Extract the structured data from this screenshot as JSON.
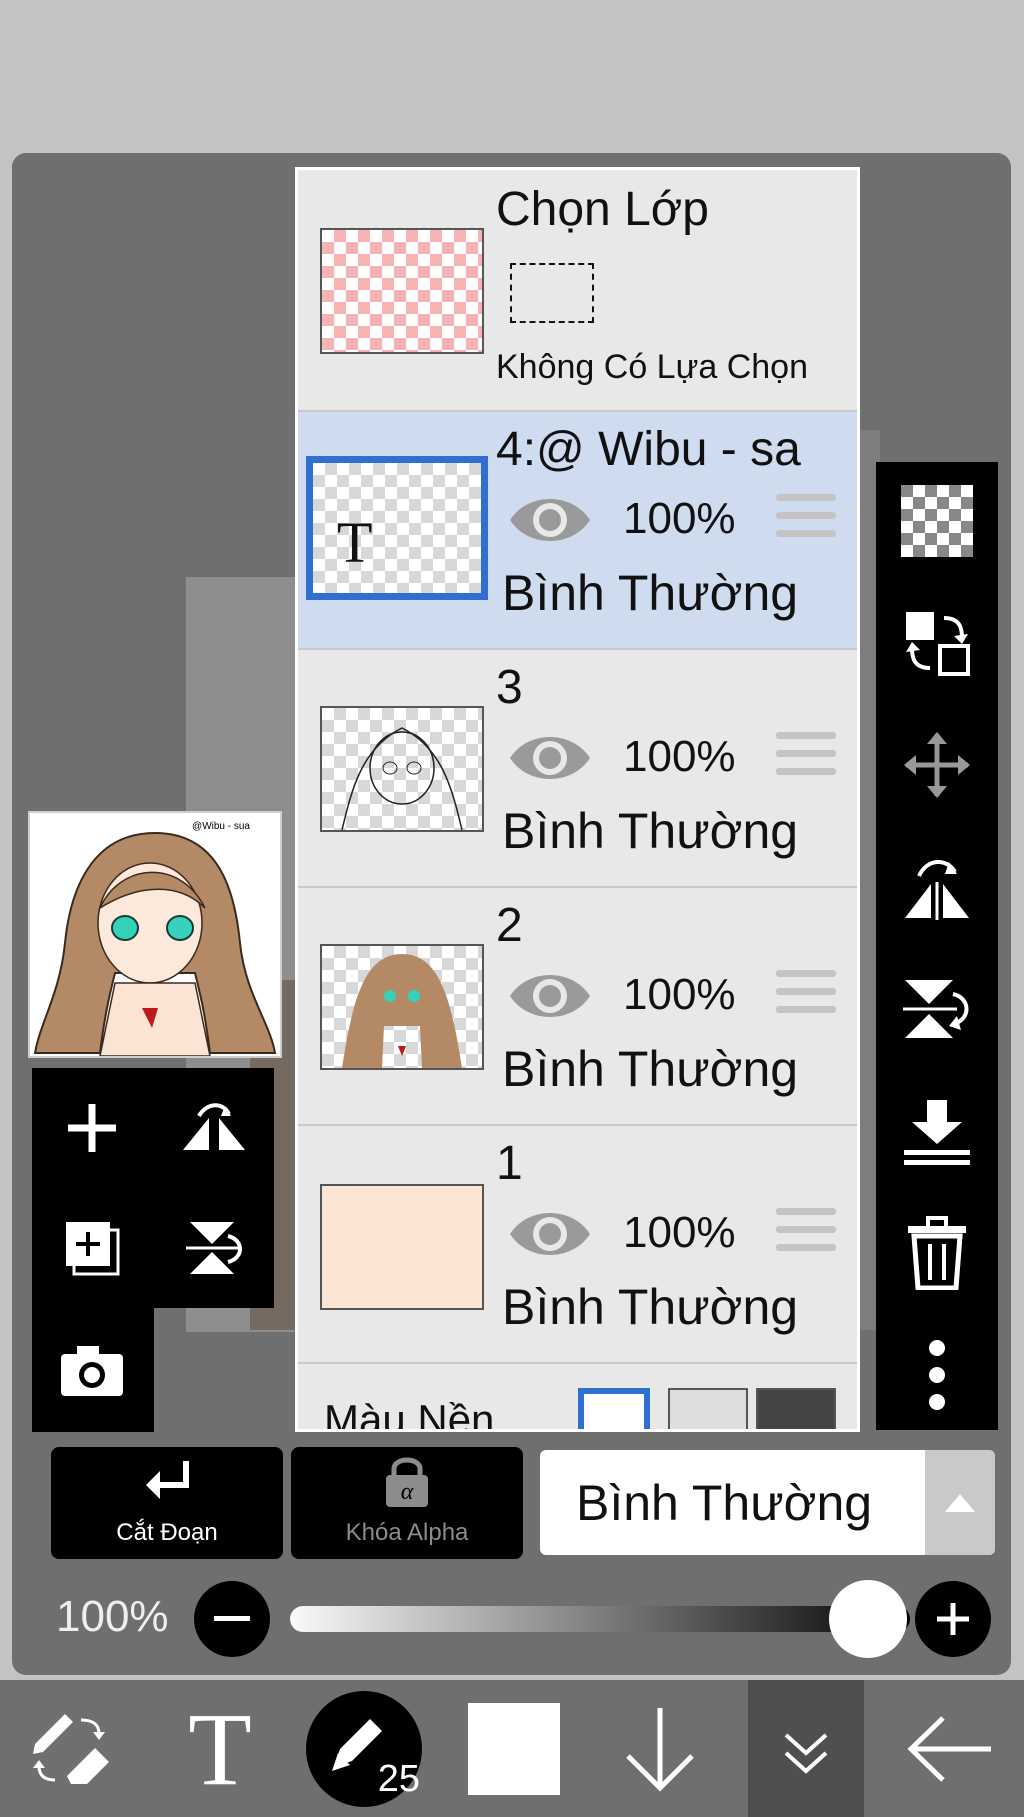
{
  "layer_panel": {
    "selection_layer": {
      "title": "Chọn Lớp",
      "status": "Không Có Lựa Chọn"
    },
    "layers": [
      {
        "name": "4:@ Wibu - sa",
        "opacity": "100%",
        "blend": "Bình Thường",
        "selected": true,
        "thumb_text": "T"
      },
      {
        "name": "3",
        "opacity": "100%",
        "blend": "Bình Thường",
        "selected": false
      },
      {
        "name": "2",
        "opacity": "100%",
        "blend": "Bình Thường",
        "selected": false
      },
      {
        "name": "1",
        "opacity": "100%",
        "blend": "Bình Thường",
        "selected": false
      }
    ],
    "background_label": "Màu Nền"
  },
  "preview": {
    "signature": "@Wibu - sua"
  },
  "actions": {
    "clipping_label": "Cắt Đoạn",
    "alpha_lock_label": "Khóa Alpha",
    "blend_mode_value": "Bình Thường"
  },
  "opacity": {
    "label": "100%",
    "value": 1.0
  },
  "bottom_toolbar": {
    "brush_size": "25"
  },
  "colors": {
    "selection_blue": "#2f6fd0",
    "selected_row": "#cfdcf0",
    "panel": "#6f6f6f"
  }
}
